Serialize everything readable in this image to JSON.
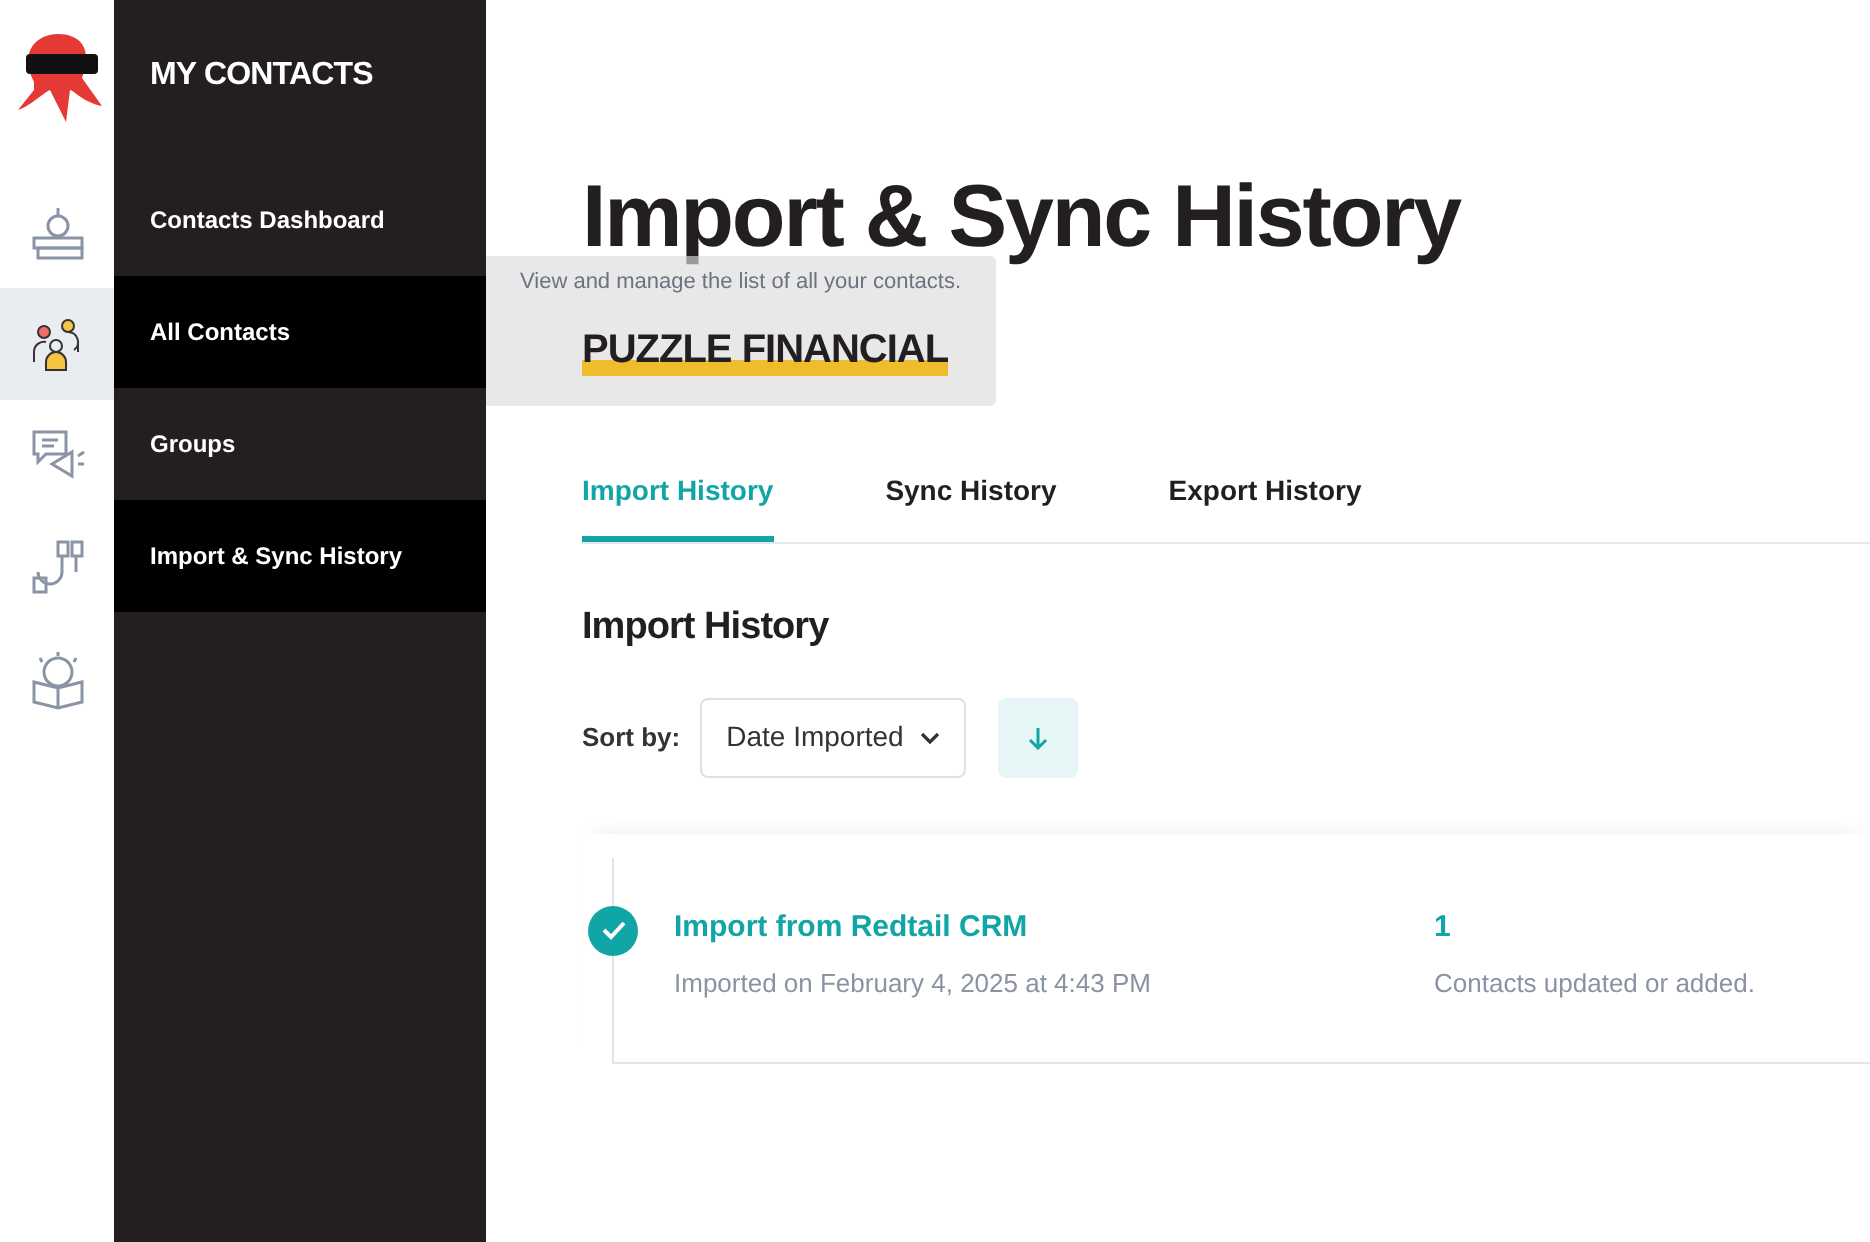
{
  "rail": [
    {
      "kind": "books",
      "selected": false
    },
    {
      "kind": "people",
      "selected": true
    },
    {
      "kind": "megaphone",
      "selected": false
    },
    {
      "kind": "cables",
      "selected": false
    },
    {
      "kind": "reading",
      "selected": false
    }
  ],
  "sidebar": {
    "title": "MY CONTACTS",
    "items": [
      {
        "label": "Contacts Dashboard",
        "highlighted": false
      },
      {
        "label": "All Contacts",
        "highlighted": true
      },
      {
        "label": "Groups",
        "highlighted": false
      },
      {
        "label": "Import & Sync History",
        "highlighted": true
      }
    ]
  },
  "tooltip": "View and manage the list of all your contacts.",
  "page": {
    "title": "Import & Sync History",
    "company": "PUZZLE FINANCIAL"
  },
  "tabs": [
    {
      "label": "Import History",
      "selected": true
    },
    {
      "label": "Sync History",
      "selected": false
    },
    {
      "label": "Export History",
      "selected": false
    }
  ],
  "section": {
    "title": "Import History",
    "sort_label": "Sort by:",
    "sort_value": "Date Imported"
  },
  "imports": [
    {
      "title": "Import from Redtail CRM",
      "date": "Imported on February 4, 2025 at 4:43 PM",
      "count": "1",
      "count_label": "Contacts updated or added.",
      "success": true
    }
  ]
}
